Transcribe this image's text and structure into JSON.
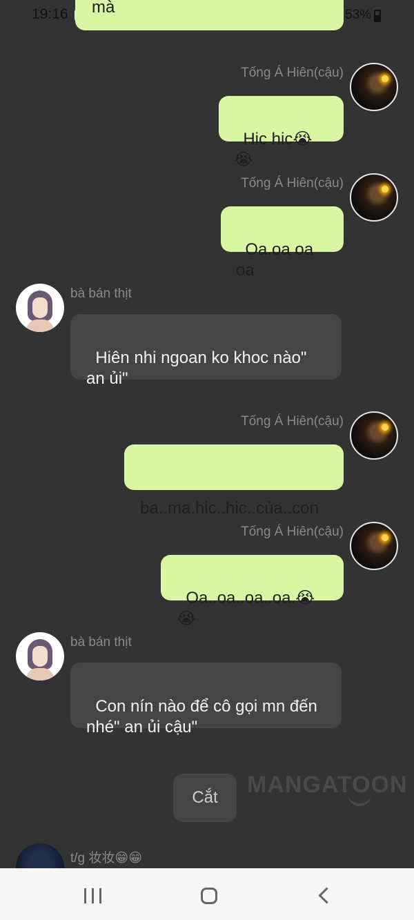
{
  "status": {
    "time": "19:16",
    "battery": "53%"
  },
  "top_partial_text": "mà",
  "messages": [
    {
      "sender": "Tống Á Hiên(cậu)",
      "text": "Hic hic😭😭",
      "side": "right"
    },
    {
      "sender": "Tống Á Hiên(cậu)",
      "text": "Oa.oa oa oa",
      "side": "right"
    },
    {
      "sender": "bà bán thịt",
      "text": "Hiên nhi ngoan ko khoc nào\"\nan ủi\"",
      "side": "left"
    },
    {
      "sender": "Tống Á Hiên(cậu)",
      "text": "ba..ma.hic..hic..của..con",
      "side": "right"
    },
    {
      "sender": "Tống Á Hiên(cậu)",
      "text": "Oa..oa..oa..oa.😭😭",
      "side": "right"
    },
    {
      "sender": "bà bán thịt",
      "text": "Con nín nào để cô gọi mn đến\nnhé\" an ủi cậu\"",
      "side": "left"
    }
  ],
  "cut_button": "Cắt",
  "watermark": "MANGATOON",
  "last_message_sender": "t/g 妆妆😁😁",
  "colors": {
    "background": "#333333",
    "bubble_self": "#d9f7a2",
    "bubble_other": "#454545",
    "name_text": "#8a8a8a"
  }
}
